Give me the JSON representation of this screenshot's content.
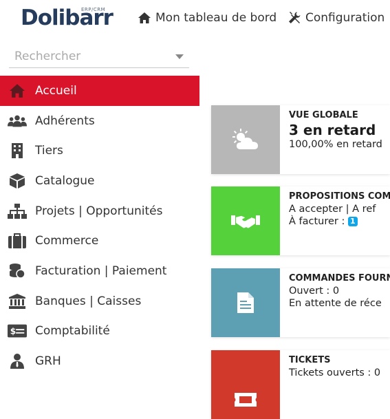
{
  "logo": {
    "main": "Dolibarr",
    "sub": "ERP/CRM"
  },
  "topnav": {
    "home_label": "Mon tableau de bord",
    "config_label": "Configuration"
  },
  "search": {
    "placeholder": "Rechercher"
  },
  "menu": [
    {
      "label": "Accueil",
      "icon": "home-icon",
      "active": true
    },
    {
      "label": "Adhérents",
      "icon": "users-icon"
    },
    {
      "label": "Tiers",
      "icon": "building-icon"
    },
    {
      "label": "Catalogue",
      "icon": "box-icon"
    },
    {
      "label": "Projets | Opportunités",
      "icon": "sitemap-icon"
    },
    {
      "label": "Commerce",
      "icon": "briefcase-icon"
    },
    {
      "label": "Facturation | Paiement",
      "icon": "coins-icon"
    },
    {
      "label": "Banques | Caisses",
      "icon": "bank-icon"
    },
    {
      "label": "Comptabilité",
      "icon": "money-check-icon"
    },
    {
      "label": "GRH",
      "icon": "user-tie-icon"
    }
  ],
  "tiles": {
    "overview": {
      "title": "VUE GLOBALE",
      "big": "3 en retard",
      "line": "100,00% en retard",
      "color": "#b7b7b7"
    },
    "proposals": {
      "title": "PROPOSITIONS COM",
      "line1": "A accepter | A ref",
      "line2": "À facturer : ",
      "badge": "1",
      "color": "#55d23b"
    },
    "orders": {
      "title": "COMMANDES FOURN",
      "line1": "Ouvert : 0",
      "line2": "En attente de réce",
      "color": "#5d9fb3"
    },
    "tickets": {
      "title": "TICKETS",
      "line1": "Tickets ouverts : 0",
      "color": "#d13a2a"
    }
  },
  "colors": {
    "accent": "#d8132a",
    "brand": "#263c5c"
  }
}
